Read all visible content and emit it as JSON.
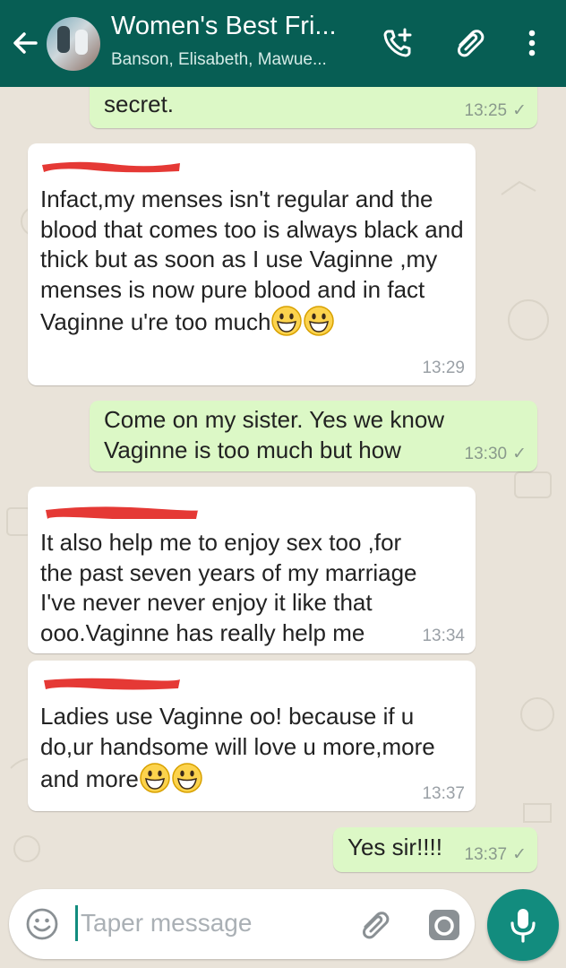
{
  "header": {
    "title": "Women's Best Fri...",
    "subtitle": "Banson, Elisabeth, Mawue..."
  },
  "messages": [
    {
      "dir": "out",
      "text": "secret.",
      "time": "13:25",
      "status": "✓"
    },
    {
      "dir": "in",
      "text": "Infact,my menses isn't regular and the blood that comes too is always black and thick but as soon as I use Vaginne ,my menses is now pure blood and in fact Vaginne u're too much",
      "time": "13:29"
    },
    {
      "dir": "out",
      "text": "Come on my sister. Yes we know Vaginne is too much but how",
      "time": "13:30",
      "status": "✓"
    },
    {
      "dir": "in",
      "text": "It also help me to enjoy sex too ,for the past seven years of my marriage I've never never enjoy it like that ooo.Vaginne has really help me",
      "time": "13:34"
    },
    {
      "dir": "in",
      "text": "Ladies use Vaginne oo! because if u do,ur handsome will love u more,more and more",
      "time": "13:37"
    },
    {
      "dir": "out",
      "text": "Yes sir!!!!",
      "time": "13:37",
      "status": "✓"
    }
  ],
  "input": {
    "placeholder": "Taper message"
  },
  "colors": {
    "header": "#075e54",
    "outgoing": "#dcf8c6",
    "incoming": "#ffffff",
    "mic": "#128c7e",
    "redaction": "#e53935"
  }
}
